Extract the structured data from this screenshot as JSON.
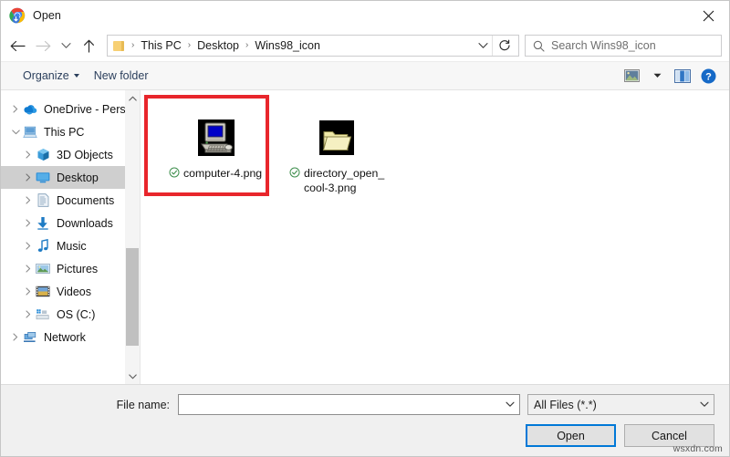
{
  "window": {
    "title": "Open",
    "app_icon": "chrome-download-icon",
    "close_label": "✕"
  },
  "nav": {
    "back_icon": "arrow-left-icon",
    "forward_icon": "arrow-right-icon",
    "recent_icon": "chevron-down-icon",
    "up_icon": "arrow-up-icon",
    "breadcrumb_folder_icon": "folder-icon",
    "breadcrumbs": [
      "This PC",
      "Desktop",
      "Wins98_icon"
    ],
    "separator": "›",
    "dropdown_icon": "chevron-down-icon",
    "refresh_icon": "refresh-icon"
  },
  "search": {
    "placeholder": "Search Wins98_icon",
    "value": "",
    "icon": "search-icon"
  },
  "commandbar": {
    "organize_label": "Organize",
    "new_folder_label": "New folder",
    "view_icon": "picture-view-icon",
    "view_caret_icon": "chevron-down-icon",
    "pane_icon": "preview-pane-icon",
    "help_icon": "help-icon",
    "help_glyph": "?"
  },
  "sidebar": {
    "items": [
      {
        "label": "OneDrive - Person",
        "icon": "onedrive-cloud-icon",
        "indent": 1,
        "expander": "›",
        "has_expander": true,
        "selected": false
      },
      {
        "label": "This PC",
        "icon": "this-pc-icon",
        "indent": 1,
        "expander": "⌄",
        "has_expander": true,
        "selected": false
      },
      {
        "label": "3D Objects",
        "icon": "3d-objects-icon",
        "indent": 2,
        "expander": "›",
        "has_expander": true,
        "selected": false
      },
      {
        "label": "Desktop",
        "icon": "desktop-icon",
        "indent": 2,
        "expander": "›",
        "has_expander": true,
        "selected": true
      },
      {
        "label": "Documents",
        "icon": "documents-icon",
        "indent": 2,
        "expander": "›",
        "has_expander": true,
        "selected": false
      },
      {
        "label": "Downloads",
        "icon": "downloads-icon",
        "indent": 2,
        "expander": "›",
        "has_expander": true,
        "selected": false
      },
      {
        "label": "Music",
        "icon": "music-icon",
        "indent": 2,
        "expander": "›",
        "has_expander": true,
        "selected": false
      },
      {
        "label": "Pictures",
        "icon": "pictures-icon",
        "indent": 2,
        "expander": "›",
        "has_expander": true,
        "selected": false
      },
      {
        "label": "Videos",
        "icon": "videos-icon",
        "indent": 2,
        "expander": "›",
        "has_expander": true,
        "selected": false
      },
      {
        "label": "OS (C:)",
        "icon": "drive-icon",
        "indent": 2,
        "expander": "›",
        "has_expander": true,
        "selected": false
      },
      {
        "label": "Network",
        "icon": "network-icon",
        "indent": 1,
        "expander": "›",
        "has_expander": true,
        "selected": false
      }
    ],
    "scroll_up_icon": "chevron-up-icon",
    "scroll_down_icon": "chevron-down-icon"
  },
  "files": [
    {
      "name": "computer-4.png",
      "icon": "win98-computer-icon",
      "sync_status_icon": "cloud-synced-check-icon",
      "highlighted": true
    },
    {
      "name": "directory_open_cool-3.png",
      "icon": "win98-open-folder-icon",
      "sync_status_icon": "cloud-synced-check-icon",
      "highlighted": false
    }
  ],
  "annotation": {
    "highlight_color": "#e8262c",
    "shape": "rectangle"
  },
  "footer": {
    "filename_label": "File name:",
    "filename_value": "",
    "filename_dropdown_icon": "chevron-down-icon",
    "filter_value": "All Files (*.*)",
    "filter_dropdown_icon": "chevron-down-icon",
    "open_label": "Open",
    "cancel_label": "Cancel"
  },
  "watermark": {
    "text": "wsxdn.com"
  },
  "colors": {
    "accent": "#0078d7",
    "selection": "#cfcfcf",
    "annotation": "#e8262c",
    "command_text": "#2b3f5c"
  }
}
